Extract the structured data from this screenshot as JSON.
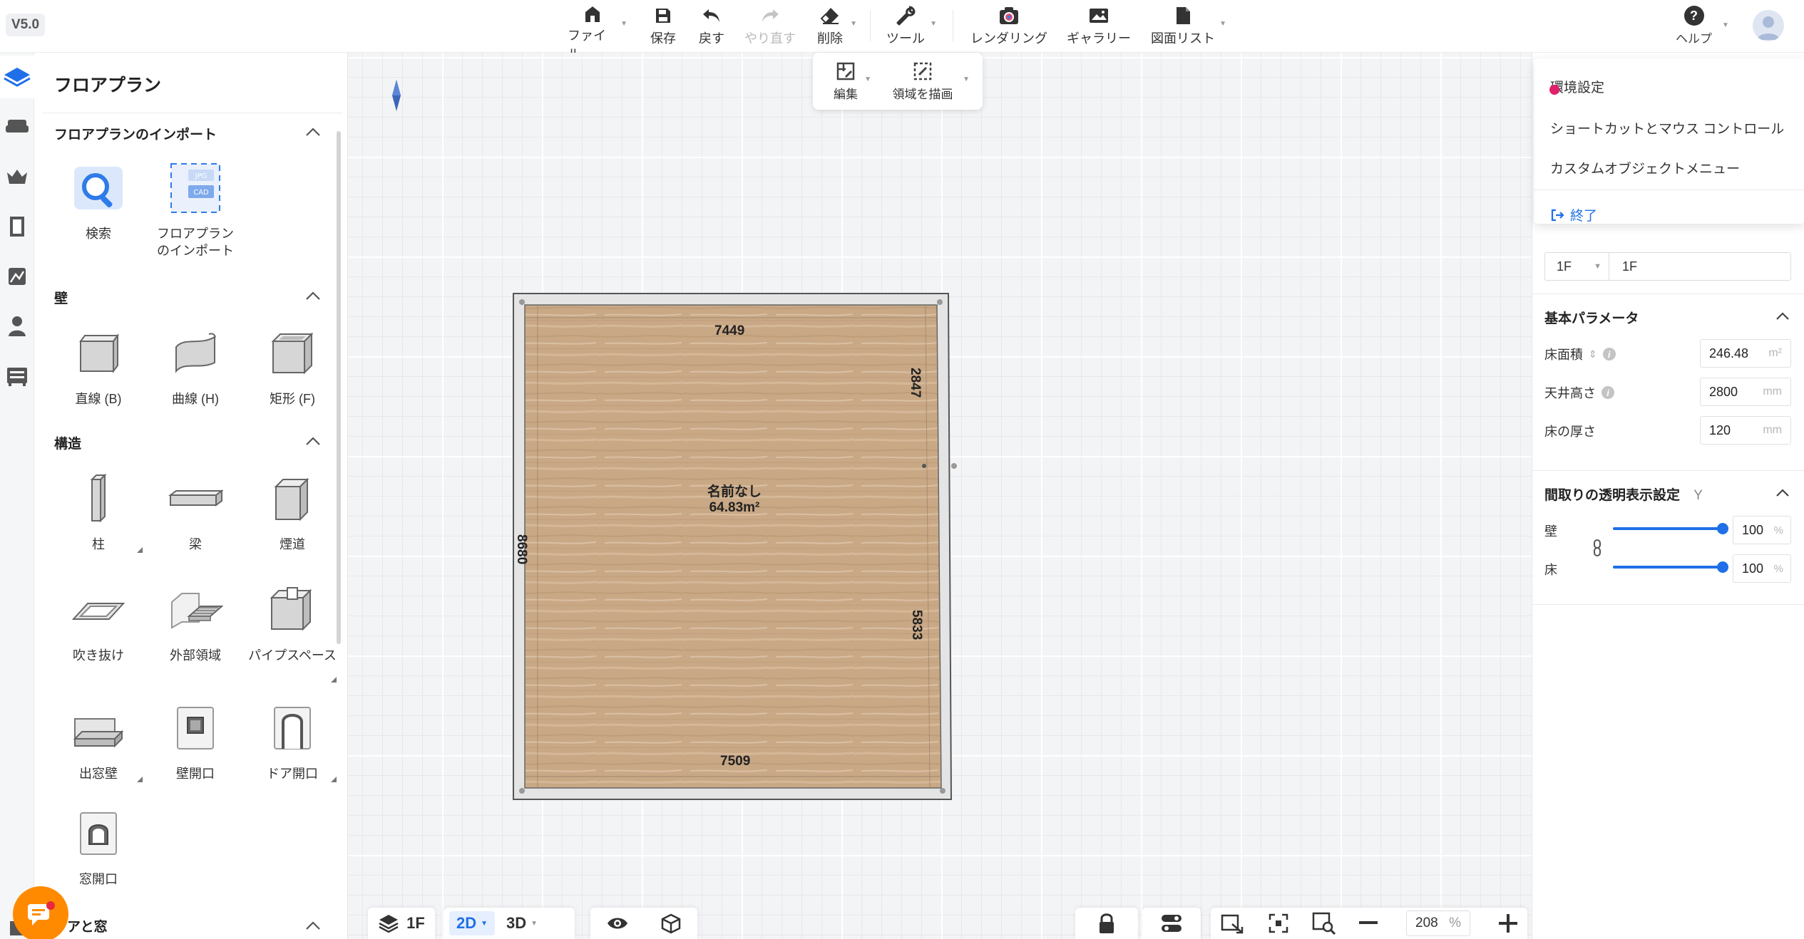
{
  "app": {
    "version": "V5.0"
  },
  "toolbar": {
    "file": "ファイル",
    "save": "保存",
    "undo": "戻す",
    "redo": "やり直す",
    "delete": "削除",
    "tools": "ツール",
    "rendering": "レンダリング",
    "gallery": "ギャラリー",
    "drawing_list": "図面リスト",
    "help": "ヘルプ"
  },
  "edit_popover": {
    "edit": "編集",
    "draw_region": "領域を描画"
  },
  "left_panel": {
    "title": "フロアプラン",
    "sections": {
      "import": {
        "header": "フロアプランのインポート",
        "items": [
          "検索",
          "フロアプラン\nのインポート"
        ]
      },
      "walls": {
        "header": "壁",
        "items": [
          "直線 (B)",
          "曲線 (H)",
          "矩形 (F)"
        ]
      },
      "structure": {
        "header": "構造",
        "items": [
          "柱",
          "梁",
          "煙道",
          "吹き抜け",
          "外部領域",
          "パイプスペース",
          "出窓壁",
          "壁開口",
          "ドア開口",
          "窓開口"
        ]
      },
      "doors": {
        "header": "アと窓"
      }
    },
    "import_badges": {
      "jpg": "JPG",
      "cad": "CAD"
    }
  },
  "floorplan": {
    "room_name": "名前なし",
    "room_area": "64.83m²",
    "dim_top": "7449",
    "dim_bottom": "7509",
    "dim_left": "8680",
    "dim_right_upper": "2847",
    "dim_right_lower": "5833"
  },
  "settings_menu": {
    "items": [
      "環境設定",
      "ショートカットとマウス コントロール",
      "カスタムオブジェクトメニュー"
    ],
    "exit": "終了"
  },
  "right_panel": {
    "floor_select": "1F",
    "floor_name": "1F",
    "basic_params": {
      "header": "基本パラメータ",
      "floor_area_label": "床面積",
      "floor_area": "246.48",
      "floor_area_unit": "m²",
      "ceiling_height_label": "天井高さ",
      "ceiling_height": "2800",
      "ceiling_height_unit": "mm",
      "floor_thickness_label": "床の厚さ",
      "floor_thickness": "120",
      "floor_thickness_unit": "mm"
    },
    "transparency": {
      "header": "間取りの透明表示設定",
      "shortcut": "Y",
      "wall_label": "壁",
      "wall_value": "100",
      "floor_label": "床",
      "floor_value": "100",
      "unit": "%",
      "wall_level": 1.0,
      "floor_level": 1.0
    }
  },
  "bottom_bar": {
    "floor": "1F",
    "view2d": "2D",
    "view3d": "3D",
    "zoom": "208",
    "zoom_unit": "%"
  },
  "colors": {
    "accent": "#1f6fe8",
    "floor_wood": "#c9a886",
    "chat": "#ff8a00"
  }
}
